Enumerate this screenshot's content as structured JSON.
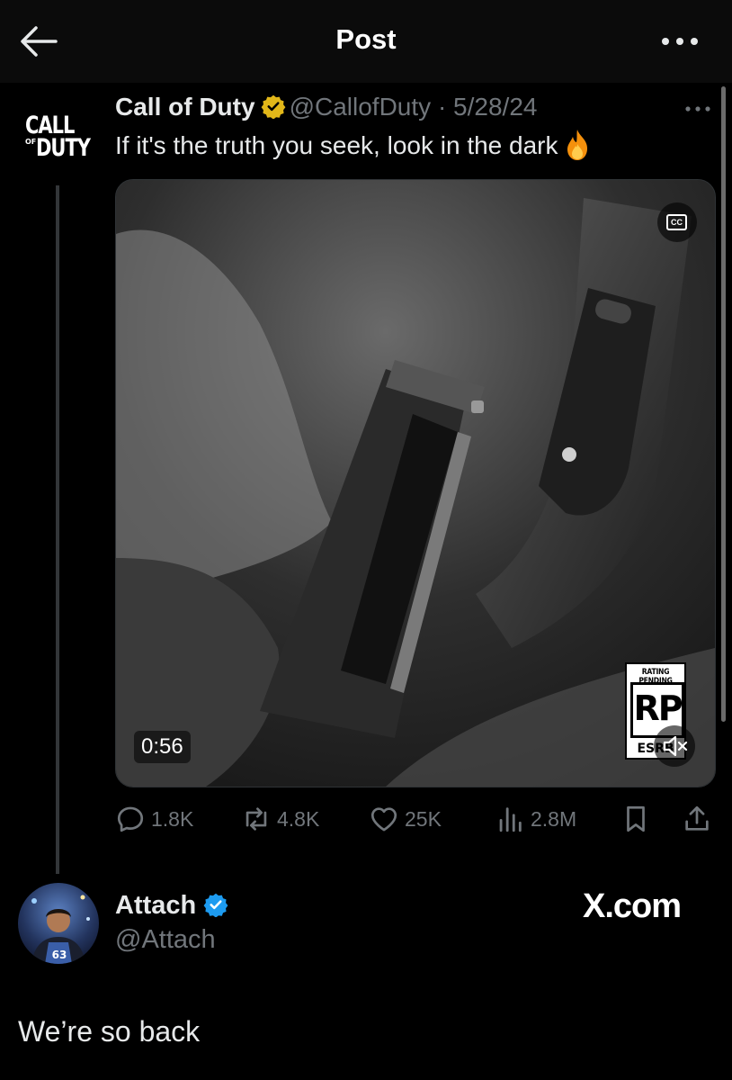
{
  "header": {
    "title": "Post",
    "back_icon": "arrow-left-icon",
    "more_icon": "more-horizontal-icon"
  },
  "quoted_post": {
    "avatar_logo": {
      "line1": "CALL",
      "line2": "OF",
      "line3": "DUTY"
    },
    "author_name": "Call of Duty",
    "verified": "gold-verified-badge-icon",
    "handle": "@CallofDuty",
    "separator": "·",
    "date": "5/28/24",
    "text": "If it's the truth you seek, look in the dark",
    "emoji": "fire-icon",
    "media": {
      "duration": "0:56",
      "cc_label": "CC",
      "esrb": {
        "top": "RATING PENDING",
        "rating": "RP",
        "bottom": "ESRB"
      },
      "sound": "muted-speaker-icon"
    },
    "metrics": {
      "replies": "1.8K",
      "reposts": "4.8K",
      "likes": "25K",
      "views": "2.8M"
    }
  },
  "reply": {
    "author_name": "Attach",
    "verified": "blue-verified-badge-icon",
    "handle": "@Attach",
    "text": "We’re so back"
  },
  "watermark": "X.com",
  "colors": {
    "background": "#000000",
    "header_bg": "#0b0b0b",
    "text": "#e7e9ea",
    "muted": "#71767b",
    "verified_gold": "#e2b719",
    "verified_blue": "#1d9bf0",
    "fire": "#f4900c"
  }
}
